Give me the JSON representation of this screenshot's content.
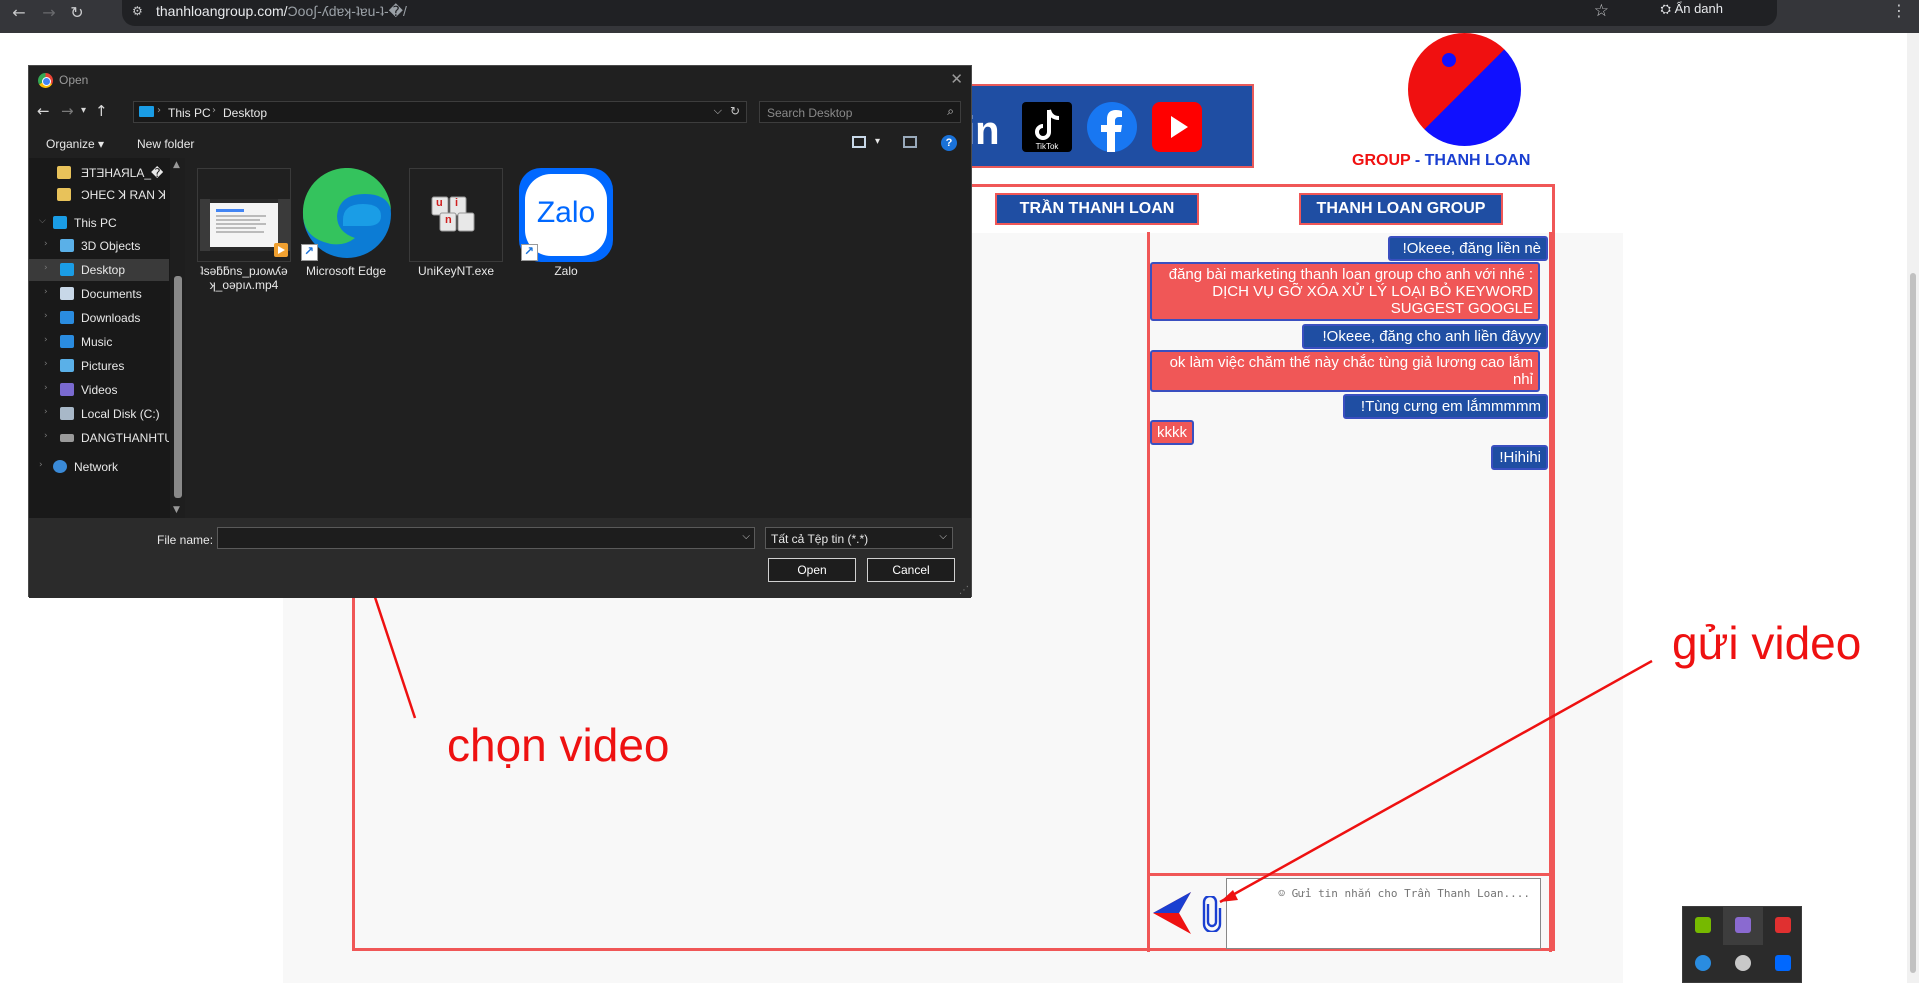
{
  "browser": {
    "url_host": "thanhloangroup.com/",
    "url_path": "Ɔoo∫-ʎdɐʞ-ʇɐu-ʇ-�/",
    "incognito_label": "Ẩn danh"
  },
  "page": {
    "logo_text_group": "GROUP",
    "logo_text_dash": " - ",
    "logo_text_name": "THANH LOAN",
    "tab_left": "TRẦN THANH LOAN",
    "tab_right": "THANH LOAN GROUP",
    "tiktok_label": "TikTok",
    "chat_messages": [
      {
        "text": "!Okeee, đăng liền nè",
        "side": "blue"
      },
      {
        "text": "đăng bài marketing thanh loan group cho anh với nhé : DỊCH VỤ GỠ XÓA XỬ LÝ LOẠI BỎ KEYWORD SUGGEST GOOGLE",
        "side": "red"
      },
      {
        "text": "!Okeee, đăng cho anh liền đâyyy",
        "side": "blue"
      },
      {
        "text": "ok làm việc chăm thế này chắc tùng giả lương cao lắm nhỉ",
        "side": "red"
      },
      {
        "text": "!Tùng cưng em lắmmmmm",
        "side": "blue"
      },
      {
        "text": "kkkk",
        "side": "red"
      },
      {
        "text": "!Hihihi",
        "side": "blue"
      }
    ],
    "chat_input_placeholder": "☺ Gửi tin nhắn cho Trần Thanh Loan...."
  },
  "annotations": {
    "choose_video": "chọn video",
    "send_video": "gửi video"
  },
  "dialog": {
    "title": "Open",
    "crumbs": [
      "This PC",
      "Desktop"
    ],
    "search_placeholder": "Search Desktop",
    "organize": "Organize ▾",
    "new_folder": "New folder",
    "help": "?",
    "nav_items": [
      {
        "label": "ƎTƎHAЯLA_�",
        "kind": "folder"
      },
      {
        "label": "ƆHEC ꓘ RAN ꓘ",
        "kind": "folder"
      },
      {
        "label": "This PC",
        "kind": "pc"
      },
      {
        "label": "3D Objects",
        "kind": "obj"
      },
      {
        "label": "Desktop",
        "kind": "desk"
      },
      {
        "label": "Documents",
        "kind": "docs"
      },
      {
        "label": "Downloads",
        "kind": "down"
      },
      {
        "label": "Music",
        "kind": "music"
      },
      {
        "label": "Pictures",
        "kind": "pics"
      },
      {
        "label": "Videos",
        "kind": "vids"
      },
      {
        "label": "Local Disk (C:)",
        "kind": "disk"
      },
      {
        "label": "DANGTHANHTU",
        "kind": "drive"
      },
      {
        "label": "Network",
        "kind": "net"
      }
    ],
    "files": [
      {
        "name": "keyword_suggest_video.mp4",
        "display": "ʇsǝƃƃns_pɹoʍʎǝ\nʞ_oǝpıʌ.mp4"
      },
      {
        "name": "Microsoft Edge",
        "display": "Microsoft Edge"
      },
      {
        "name": "UniKeyNT.exe",
        "display": "UniKeyNT.exe"
      },
      {
        "name": "Zalo",
        "display": "Zalo"
      }
    ],
    "filename_label": "File name:",
    "filetype_value": "Tất cả Tệp tin (*.*)",
    "open_button": "Open",
    "cancel_button": "Cancel",
    "unikey_keys": [
      "u",
      "i",
      "n"
    ],
    "zalo_logo": "Zalo"
  },
  "colors": {
    "brand_blue": "#1f4ea3",
    "brand_red": "#f05757",
    "annotation_red": "#ee1111"
  }
}
